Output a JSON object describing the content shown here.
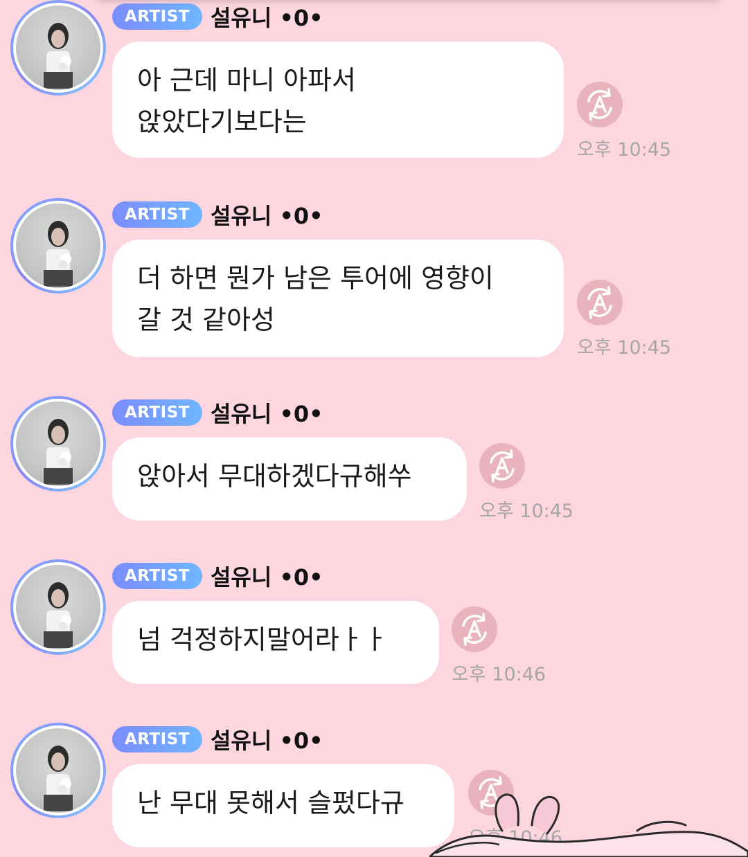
{
  "colors": {
    "background": "#fdd6df",
    "bubble": "#ffffff",
    "badge_start": "#7b8cff",
    "badge_end": "#6fb6ff",
    "timestamp": "#a6a6a6",
    "translate_icon": "#e8b3bd"
  },
  "messages": [
    {
      "badge": "ARTIST",
      "sender": "설유니 •0•",
      "text": "아 근데 마니 아파서\n앉았다기보다는",
      "time": "오후 10:45",
      "icon": "translate-icon"
    },
    {
      "badge": "ARTIST",
      "sender": "설유니 •0•",
      "text": "더 하면 뭔가 남은 투어에 영향이\n갈 것 같아성",
      "time": "오후 10:45",
      "icon": "translate-icon"
    },
    {
      "badge": "ARTIST",
      "sender": "설유니 •0•",
      "text": "앉아서 무대하겠다규해쑤",
      "time": "오후 10:45",
      "icon": "translate-icon"
    },
    {
      "badge": "ARTIST",
      "sender": "설유니 •0•",
      "text": "넘 걱정하지말어라ㅏㅏ",
      "time": "오후 10:46",
      "icon": "translate-icon"
    },
    {
      "badge": "ARTIST",
      "sender": "설유니 •0•",
      "text": "난 무대 못해서 슬펐다규",
      "time": "오후 10:46",
      "icon": "translate-icon"
    }
  ],
  "sticker": {
    "icon": "bunny-sticker-icon"
  }
}
